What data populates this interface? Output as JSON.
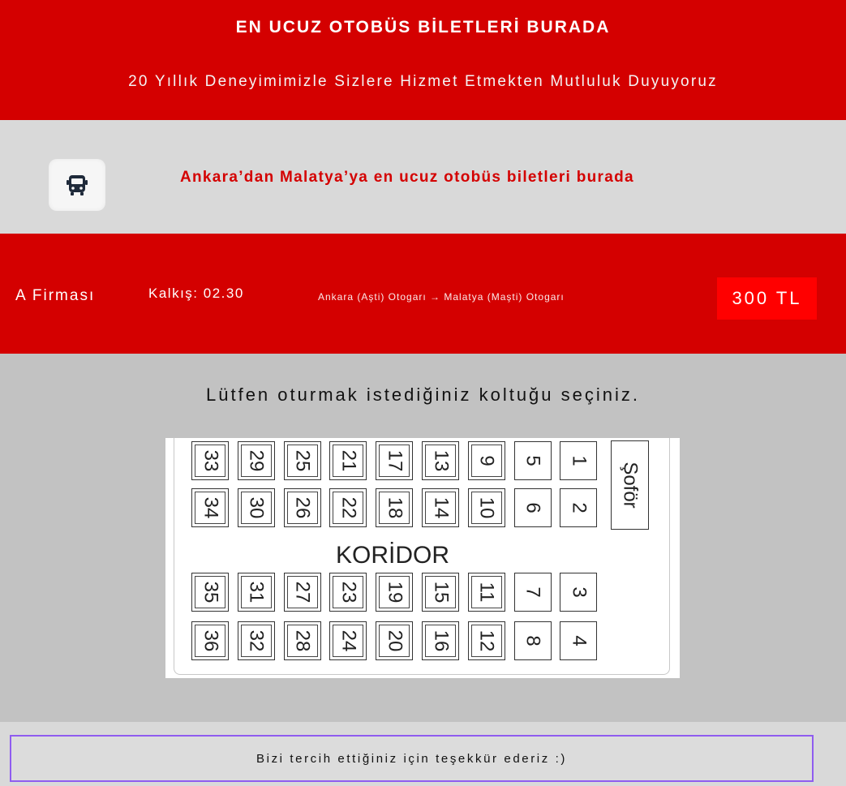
{
  "header": {
    "title": "EN UCUZ OTOBÜS BİLETLERİ BURADA",
    "subtitle": "20 Yıllık Deneyimimizle Sizlere Hizmet Etmekten Mutluluk Duyuyoruz"
  },
  "banner": {
    "icon": "bus-icon",
    "text": "Ankara’dan Malatya’ya en ucuz otobüs biletleri burada"
  },
  "trip": {
    "company": "A Firması",
    "departure": "Kalkış: 02.30",
    "route": "Ankara (Aşti) Otogarı → Malatya (Maşti) Otogarı",
    "price": "300 TL"
  },
  "seat_selection": {
    "prompt": "Lütfen oturmak istediğiniz koltuğu seçiniz.",
    "driver_label": "Şoför",
    "corridor_label": "KORİDOR",
    "rows": [
      [
        "33",
        "29",
        "25",
        "21",
        "17",
        "13",
        "9",
        "5",
        "1"
      ],
      [
        "34",
        "30",
        "26",
        "22",
        "18",
        "14",
        "10",
        "6",
        "2"
      ],
      [
        "35",
        "31",
        "27",
        "23",
        "19",
        "15",
        "11",
        "7",
        "3"
      ],
      [
        "36",
        "32",
        "28",
        "24",
        "20",
        "16",
        "12",
        "8",
        "4"
      ]
    ]
  },
  "footer": {
    "text": "Bizi tercih ettiğiniz için teşekkür ederiz :)"
  },
  "colors": {
    "brand_red": "#d40000",
    "price_red": "#ff0000",
    "footer_border": "#8f5cf0"
  }
}
